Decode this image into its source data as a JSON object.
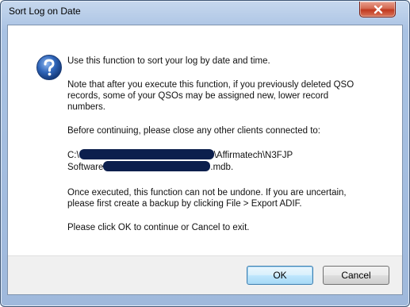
{
  "window": {
    "title": "Sort Log on Date"
  },
  "dialog": {
    "line1": "Use this function to sort your log by date and time.",
    "para2": [
      "Note that after you execute this function, if you previously deleted QSO",
      "records, some of your QSOs may be assigned new, lower record",
      "numbers."
    ],
    "line3": "Before continuing, please close any other clients connected to:",
    "path_line1_prefix": "C:\\",
    "path_line1_suffix": "\\Affirmatech\\N3FJP",
    "path_line2_prefix": "Software",
    "path_line2_suffix": ".mdb.",
    "para4": [
      "Once executed, this function can not be undone.  If you are uncertain,",
      "please first create a backup by clicking File > Export ADIF."
    ],
    "line5": "Please click OK to continue or Cancel to exit."
  },
  "buttons": {
    "ok_label": "OK",
    "cancel_label": "Cancel"
  },
  "icons": {
    "info": "question-icon",
    "close": "close-icon"
  },
  "colors": {
    "close_button": "#c7432a",
    "redaction": "#0c1f4d",
    "info_icon": "#2a5fb0"
  }
}
